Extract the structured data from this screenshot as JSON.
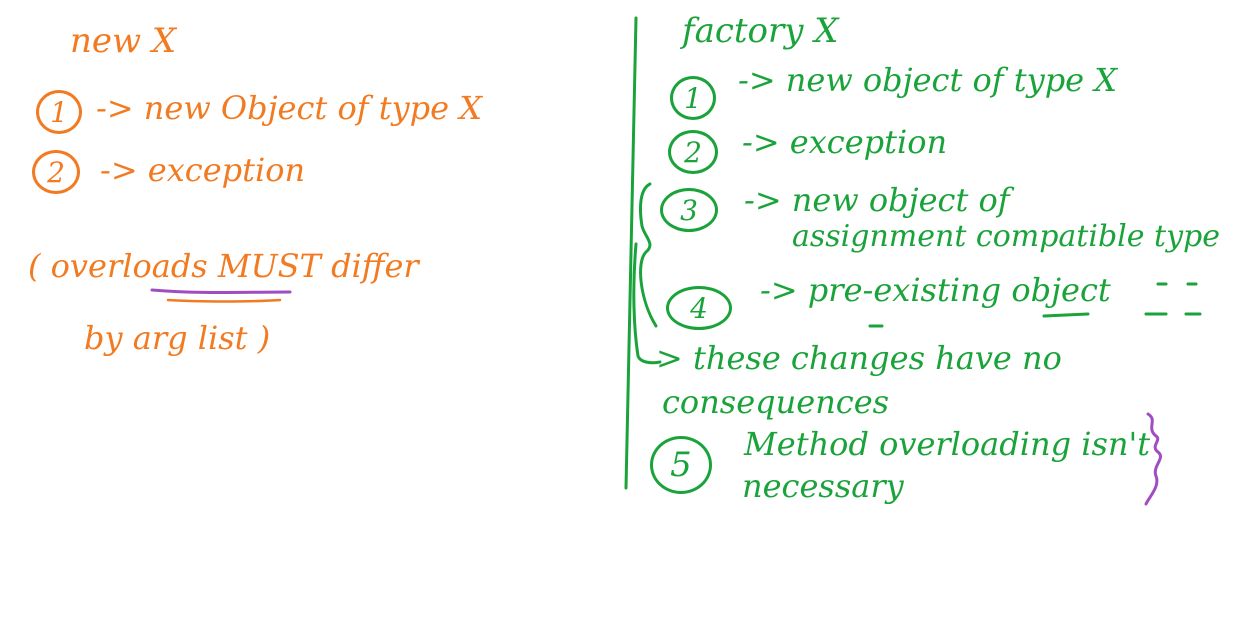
{
  "left": {
    "title": "new X",
    "items": [
      {
        "num": "1",
        "text": "-> new Object of type X"
      },
      {
        "num": "2",
        "text": "-> exception"
      }
    ],
    "note_line1": "( overloads MUST differ",
    "note_line2": "by arg list )"
  },
  "right": {
    "title": "factory X",
    "items": [
      {
        "num": "1",
        "text": "-> new object of type X"
      },
      {
        "num": "2",
        "text": "-> exception"
      },
      {
        "num": "3",
        "text": "-> new object of",
        "text2": "assignment compatible type"
      },
      {
        "num": "4",
        "text": "-> pre-existing object"
      },
      {
        "num": "5",
        "text": "Method overloading isn't",
        "text2": "necessary"
      }
    ],
    "brace_note_line1": "> these changes have no",
    "brace_note_line2": "consequences"
  },
  "colors": {
    "orange": "#f27a21",
    "green": "#1aa33a",
    "purple": "#a24cc2",
    "background": "#ffffff"
  }
}
